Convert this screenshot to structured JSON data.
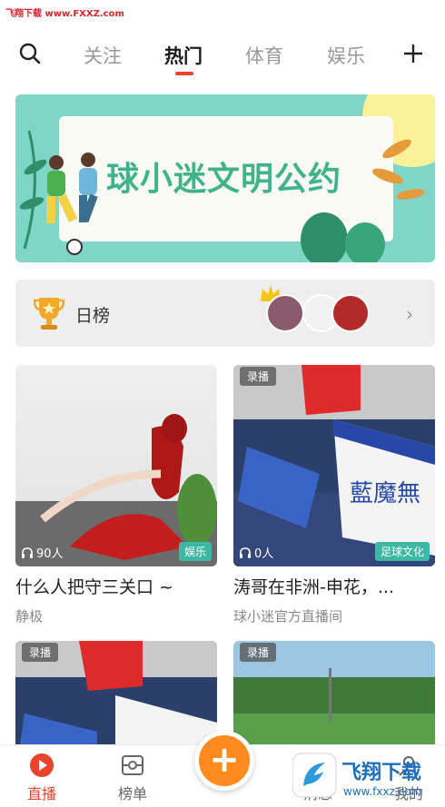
{
  "watermark": {
    "text": "飞翔下载 www.FXXZ.com"
  },
  "topnav": {
    "tabs": [
      {
        "label": "关注",
        "active": false
      },
      {
        "label": "热门",
        "active": true
      },
      {
        "label": "体育",
        "active": false
      },
      {
        "label": "娱乐",
        "active": false
      }
    ]
  },
  "banner": {
    "title": "球小迷文明公约"
  },
  "rank": {
    "label": "日榜"
  },
  "cards": [
    {
      "title": "什么人把守三关口 ~",
      "author": "静极",
      "viewers": "90人",
      "category": "娱乐",
      "recorded": ""
    },
    {
      "title": "涛哥在非洲-申花，...",
      "author": "球小迷官方直播间",
      "viewers": "0人",
      "category": "足球文化",
      "recorded": "录播"
    },
    {
      "title": "",
      "author": "",
      "viewers": "",
      "category": "",
      "recorded": "录播"
    },
    {
      "title": "",
      "author": "",
      "viewers": "",
      "category": "",
      "recorded": "录播"
    }
  ],
  "bottomnav": {
    "items": [
      {
        "label": "直播",
        "active": true
      },
      {
        "label": "榜单",
        "active": false
      },
      {
        "label": "消息",
        "active": false
      },
      {
        "label": "我的",
        "active": false
      }
    ]
  },
  "logo_watermark": {
    "name": "飞翔下载",
    "url": "www.fxxz.com"
  },
  "colors": {
    "accent": "#e8442c",
    "fab": "#ff8a1d",
    "tag": "#3db8a4"
  }
}
